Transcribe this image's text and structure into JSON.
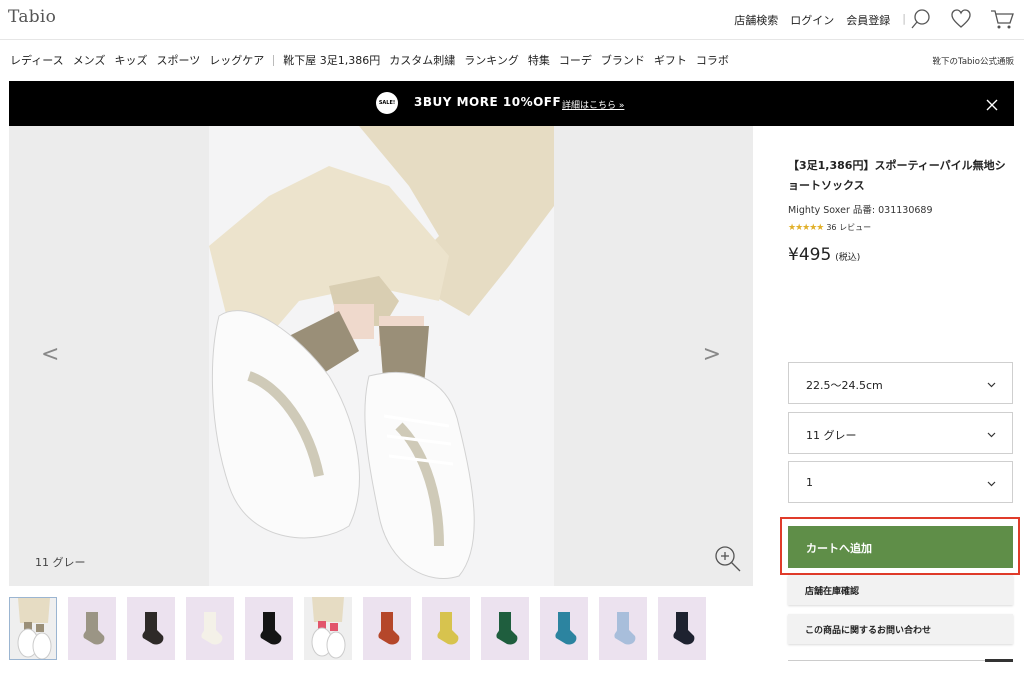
{
  "header": {
    "logo": "Tabio",
    "links": [
      "店舗検索",
      "ログイン",
      "会員登録"
    ],
    "separator": "|"
  },
  "nav": {
    "items": [
      "レディース",
      "メンズ",
      "キッズ",
      "スポーツ",
      "レッグケア"
    ],
    "items2": [
      "靴下屋 3足1,386円",
      "カスタム刺繍",
      "ランキング",
      "特集",
      "コーデ",
      "ブランド",
      "ギフト",
      "コラボ"
    ],
    "right": "靴下のTabio公式通販"
  },
  "banner": {
    "badge": "SALE!",
    "text": "3BUY MORE 10%OFF",
    "link": "詳細はこちら »"
  },
  "gallery": {
    "prev": "<",
    "next": ">",
    "color_caption": "11 グレー",
    "thumb_count": 12
  },
  "product": {
    "title": "【3足1,386円】スポーティーパイル無地ショートソックス",
    "brand_line": "Mighty Soxer 品番: 031130689",
    "stars": "★★★★★",
    "rating_value": 4.5,
    "reviews": "36 レビュー",
    "price": "¥495",
    "tax": "(税込)"
  },
  "options": {
    "size": "22.5〜24.5cm",
    "color": "11 グレー",
    "quantity": "1"
  },
  "actions": {
    "add_to_cart": "カートへ追加",
    "store_stock": "店舗在庫確認",
    "inquiry": "この商品に関するお問い合わせ"
  },
  "colors": {
    "cart_green": "#5f8e48",
    "highlight_red": "#e03b2a",
    "thumb_bg": "#ece2ef"
  },
  "thumbs": [
    {
      "name": "thumb-model",
      "color": ""
    },
    {
      "name": "thumb-sock-greige",
      "color": "#9b9585"
    },
    {
      "name": "thumb-sock-charcoal",
      "color": "#2e2a28"
    },
    {
      "name": "thumb-sock-white",
      "color": "#f4f1e8"
    },
    {
      "name": "thumb-sock-black",
      "color": "#151515"
    },
    {
      "name": "thumb-model-pink",
      "color": ""
    },
    {
      "name": "thumb-sock-rust",
      "color": "#b5472a"
    },
    {
      "name": "thumb-sock-yellow",
      "color": "#d7c34e"
    },
    {
      "name": "thumb-sock-green",
      "color": "#1f5e3e"
    },
    {
      "name": "thumb-sock-teal",
      "color": "#2c84a0"
    },
    {
      "name": "thumb-sock-light-blue",
      "color": "#a8bedb"
    },
    {
      "name": "thumb-sock-navy",
      "color": "#1e2230"
    }
  ]
}
